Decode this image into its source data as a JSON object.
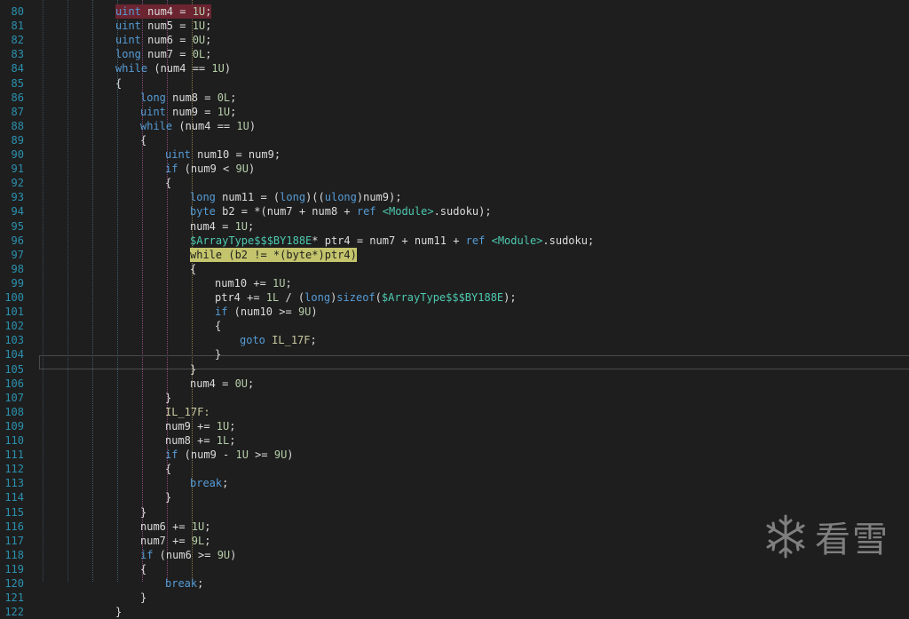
{
  "editor": {
    "lines": [
      {
        "n": "80",
        "indent": 130,
        "hl": "sel",
        "t": [
          [
            "kw",
            "uint"
          ],
          [
            "id",
            " num4 = "
          ],
          [
            "num",
            "1U"
          ],
          [
            "op",
            ";"
          ]
        ]
      },
      {
        "n": "81",
        "indent": 130,
        "t": [
          [
            "kw",
            "uint"
          ],
          [
            "id",
            " num5 = "
          ],
          [
            "num",
            "1U"
          ],
          [
            "op",
            ";"
          ]
        ]
      },
      {
        "n": "82",
        "indent": 130,
        "t": [
          [
            "kw",
            "uint"
          ],
          [
            "id",
            " num6 = "
          ],
          [
            "num",
            "0U"
          ],
          [
            "op",
            ";"
          ]
        ]
      },
      {
        "n": "83",
        "indent": 130,
        "t": [
          [
            "kw",
            "long"
          ],
          [
            "id",
            " num7 = "
          ],
          [
            "num",
            "0L"
          ],
          [
            "op",
            ";"
          ]
        ]
      },
      {
        "n": "84",
        "indent": 130,
        "t": [
          [
            "kw",
            "while"
          ],
          [
            "id",
            " (num4 == "
          ],
          [
            "num",
            "1U"
          ],
          [
            "op",
            ")"
          ]
        ]
      },
      {
        "n": "85",
        "indent": 130,
        "t": [
          [
            "op",
            "{"
          ]
        ]
      },
      {
        "n": "86",
        "indent": 158,
        "t": [
          [
            "kw",
            "long"
          ],
          [
            "id",
            " num8 = "
          ],
          [
            "num",
            "0L"
          ],
          [
            "op",
            ";"
          ]
        ]
      },
      {
        "n": "87",
        "indent": 158,
        "t": [
          [
            "kw",
            "uint"
          ],
          [
            "id",
            " num9 = "
          ],
          [
            "num",
            "1U"
          ],
          [
            "op",
            ";"
          ]
        ]
      },
      {
        "n": "88",
        "indent": 158,
        "t": [
          [
            "kw",
            "while"
          ],
          [
            "id",
            " (num4 == "
          ],
          [
            "num",
            "1U"
          ],
          [
            "op",
            ")"
          ]
        ]
      },
      {
        "n": "89",
        "indent": 158,
        "t": [
          [
            "op",
            "{"
          ]
        ]
      },
      {
        "n": "90",
        "indent": 186,
        "t": [
          [
            "kw",
            "uint"
          ],
          [
            "id",
            " num10 = num9;"
          ]
        ]
      },
      {
        "n": "91",
        "indent": 186,
        "t": [
          [
            "kw",
            "if"
          ],
          [
            "id",
            " (num9 < "
          ],
          [
            "num",
            "9U"
          ],
          [
            "op",
            ")"
          ]
        ]
      },
      {
        "n": "92",
        "indent": 186,
        "t": [
          [
            "op",
            "{"
          ]
        ]
      },
      {
        "n": "93",
        "indent": 214,
        "t": [
          [
            "kw",
            "long"
          ],
          [
            "id",
            " num11 = ("
          ],
          [
            "kw",
            "long"
          ],
          [
            "id",
            ")(("
          ],
          [
            "kw",
            "ulong"
          ],
          [
            "id",
            ")num9);"
          ]
        ]
      },
      {
        "n": "94",
        "indent": 214,
        "t": [
          [
            "kw",
            "byte"
          ],
          [
            "id",
            " b2 = *(num7 + num8 + "
          ],
          [
            "kw",
            "ref"
          ],
          [
            "id",
            " "
          ],
          [
            "gen",
            "<Module>"
          ],
          [
            "id",
            ".sudoku);"
          ]
        ]
      },
      {
        "n": "95",
        "indent": 214,
        "t": [
          [
            "id",
            "num4 = "
          ],
          [
            "num",
            "1U"
          ],
          [
            "op",
            ";"
          ]
        ]
      },
      {
        "n": "96",
        "indent": 214,
        "t": [
          [
            "type",
            "$ArrayType$$$BY188E"
          ],
          [
            "id",
            "* ptr4 = num7 + num11 + "
          ],
          [
            "kw",
            "ref"
          ],
          [
            "id",
            " "
          ],
          [
            "gen",
            "<Module>"
          ],
          [
            "id",
            ".sudoku;"
          ]
        ]
      },
      {
        "n": "97",
        "indent": 214,
        "hl": "yellow",
        "t": [
          [
            "kw",
            "while"
          ],
          [
            "id",
            " (b2 != *("
          ],
          [
            "kw",
            "byte"
          ],
          [
            "id",
            "*)ptr4)"
          ]
        ]
      },
      {
        "n": "98",
        "indent": 214,
        "t": [
          [
            "op",
            "{"
          ]
        ]
      },
      {
        "n": "99",
        "indent": 242,
        "t": [
          [
            "id",
            "num10 += "
          ],
          [
            "num",
            "1U"
          ],
          [
            "op",
            ";"
          ]
        ]
      },
      {
        "n": "100",
        "indent": 242,
        "t": [
          [
            "id",
            "ptr4 += "
          ],
          [
            "num",
            "1L"
          ],
          [
            "id",
            " / ("
          ],
          [
            "kw",
            "long"
          ],
          [
            "id",
            ")"
          ],
          [
            "kw",
            "sizeof"
          ],
          [
            "id",
            "("
          ],
          [
            "type",
            "$ArrayType$$$BY188E"
          ],
          [
            "id",
            ");"
          ]
        ]
      },
      {
        "n": "101",
        "indent": 242,
        "t": [
          [
            "kw",
            "if"
          ],
          [
            "id",
            " (num10 >= "
          ],
          [
            "num",
            "9U"
          ],
          [
            "op",
            ")"
          ]
        ]
      },
      {
        "n": "102",
        "indent": 242,
        "t": [
          [
            "op",
            "{"
          ]
        ]
      },
      {
        "n": "103",
        "indent": 270,
        "t": [
          [
            "kw",
            "goto"
          ],
          [
            "id",
            " "
          ],
          [
            "label",
            "IL_17F"
          ],
          [
            "op",
            ";"
          ]
        ]
      },
      {
        "n": "104",
        "indent": 242,
        "t": [
          [
            "op",
            "}"
          ]
        ]
      },
      {
        "n": "105",
        "indent": 214,
        "t": [
          [
            "op",
            "}"
          ]
        ]
      },
      {
        "n": "106",
        "indent": 214,
        "t": [
          [
            "id",
            "num4 = "
          ],
          [
            "num",
            "0U"
          ],
          [
            "op",
            ";"
          ]
        ]
      },
      {
        "n": "107",
        "indent": 186,
        "t": [
          [
            "op",
            "}"
          ]
        ]
      },
      {
        "n": "108",
        "indent": 186,
        "t": [
          [
            "label",
            "IL_17F:"
          ]
        ]
      },
      {
        "n": "109",
        "indent": 186,
        "t": [
          [
            "id",
            "num9 += "
          ],
          [
            "num",
            "1U"
          ],
          [
            "op",
            ";"
          ]
        ]
      },
      {
        "n": "110",
        "indent": 186,
        "t": [
          [
            "id",
            "num8 += "
          ],
          [
            "num",
            "1L"
          ],
          [
            "op",
            ";"
          ]
        ]
      },
      {
        "n": "111",
        "indent": 186,
        "t": [
          [
            "kw",
            "if"
          ],
          [
            "id",
            " (num9 - "
          ],
          [
            "num",
            "1U"
          ],
          [
            "id",
            " >= "
          ],
          [
            "num",
            "9U"
          ],
          [
            "op",
            ")"
          ]
        ]
      },
      {
        "n": "112",
        "indent": 186,
        "t": [
          [
            "op",
            "{"
          ]
        ]
      },
      {
        "n": "113",
        "indent": 214,
        "t": [
          [
            "kw",
            "break"
          ],
          [
            "op",
            ";"
          ]
        ]
      },
      {
        "n": "114",
        "indent": 186,
        "t": [
          [
            "op",
            "}"
          ]
        ]
      },
      {
        "n": "115",
        "indent": 158,
        "t": [
          [
            "op",
            "}"
          ]
        ]
      },
      {
        "n": "116",
        "indent": 158,
        "t": [
          [
            "id",
            "num6 += "
          ],
          [
            "num",
            "1U"
          ],
          [
            "op",
            ";"
          ]
        ]
      },
      {
        "n": "117",
        "indent": 158,
        "t": [
          [
            "id",
            "num7 += "
          ],
          [
            "num",
            "9L"
          ],
          [
            "op",
            ";"
          ]
        ]
      },
      {
        "n": "118",
        "indent": 158,
        "t": [
          [
            "kw",
            "if"
          ],
          [
            "id",
            " (num6 >= "
          ],
          [
            "num",
            "9U"
          ],
          [
            "op",
            ")"
          ]
        ]
      },
      {
        "n": "119",
        "indent": 158,
        "t": [
          [
            "op",
            "{"
          ]
        ]
      },
      {
        "n": "120",
        "indent": 186,
        "t": [
          [
            "kw",
            "break"
          ],
          [
            "op",
            ";"
          ]
        ]
      },
      {
        "n": "121",
        "indent": 158,
        "t": [
          [
            "op",
            "}"
          ]
        ]
      },
      {
        "n": "122",
        "indent": 130,
        "t": [
          [
            "op",
            "}"
          ]
        ]
      }
    ]
  },
  "watermark": {
    "text": "看雪",
    "icon": "snowflake-icon"
  },
  "colors": {
    "background": "#1e1e1e",
    "line_number": "#2b91af",
    "keyword": "#569cd6",
    "type": "#4ec9b0",
    "number": "#b5cea8",
    "selection": "#6b2430",
    "breakpoint_highlight": "#c4c46c"
  }
}
